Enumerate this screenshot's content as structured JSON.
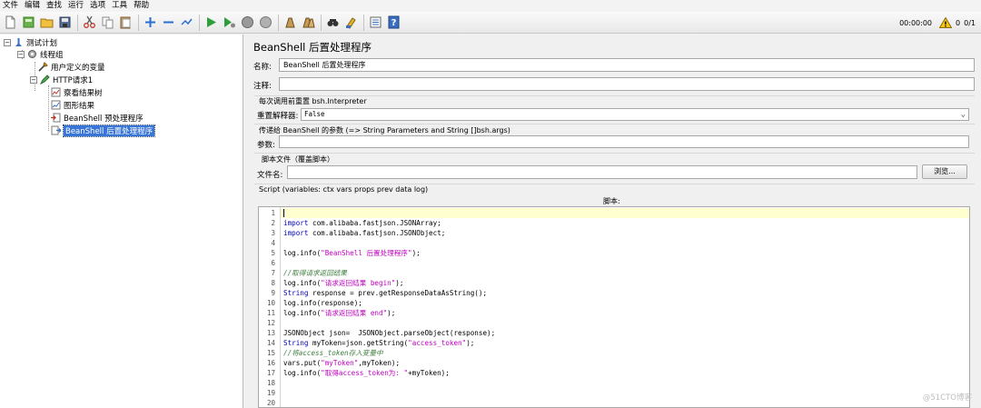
{
  "menu": [
    "文件",
    "编辑",
    "查找",
    "运行",
    "选项",
    "工具",
    "帮助"
  ],
  "toolbar_icons": [
    "new-icon",
    "templates-icon",
    "open-icon",
    "save-icon",
    "cut-icon",
    "copy-icon",
    "paste-icon",
    "expand-icon",
    "collapse-icon",
    "toggle-icon",
    "start-icon",
    "start-no-pause-icon",
    "stop-icon",
    "shutdown-icon",
    "clear-icon",
    "clear-all-icon",
    "search-icon",
    "reset-search-icon",
    "function-helper-icon",
    "help-icon"
  ],
  "status": {
    "timer": "00:00:00",
    "warnings": "0",
    "threads": "0/1"
  },
  "tree": {
    "test_plan": "测试计划",
    "thread_group": "线程组",
    "user_vars": "用户定义的变量",
    "http_request": "HTTP请求1",
    "view_results_tree": "察看结果树",
    "graph_results": "图形结果",
    "beanshell_pre": "BeanShell 预处理程序",
    "beanshell_post": "BeanShell 后置处理程序"
  },
  "panel": {
    "title": "BeanShell 后置处理程序",
    "name_label": "名称:",
    "name_value": "BeanShell 后置处理程序",
    "comment_label": "注释:",
    "comment_value": "",
    "reset_group_title": "每次调用前重置 bsh.Interpreter",
    "reset_label": "重置解释器:",
    "reset_value": "False",
    "params_group_title": "传递给 BeanShell 的参数 (=> String Parameters and String []bsh.args)",
    "params_label": "参数:",
    "params_value": "",
    "file_group_title": "脚本文件（覆盖脚本）",
    "file_label": "文件名:",
    "file_value": "",
    "browse_label": "浏览...",
    "script_group_title": "Script (variables: ctx vars props prev data log)",
    "script_label": "脚本:"
  },
  "code_lines": [
    [],
    [
      [
        "kw",
        "import"
      ],
      [
        "t",
        " com.alibaba.fastjson.JSONArray;"
      ]
    ],
    [
      [
        "kw",
        "import"
      ],
      [
        "t",
        " com.alibaba.fastjson.JSONObject;"
      ]
    ],
    [],
    [
      [
        "t",
        "log.info("
      ],
      [
        "str",
        "\"BeanShell 后置处理程序\""
      ],
      [
        "t",
        ");"
      ]
    ],
    [],
    [
      [
        "cm",
        "//取得请求返回结果"
      ]
    ],
    [
      [
        "t",
        "log.info("
      ],
      [
        "str",
        "\"请求返回结果 begin\""
      ],
      [
        "t",
        ");"
      ]
    ],
    [
      [
        "kw",
        "String"
      ],
      [
        "t",
        " response = prev.getResponseDataAsString();"
      ]
    ],
    [
      [
        "t",
        "log.info(response);"
      ]
    ],
    [
      [
        "t",
        "log.info("
      ],
      [
        "str",
        "\"请求返回结果 end\""
      ],
      [
        "t",
        ");"
      ]
    ],
    [],
    [
      [
        "t",
        "JSONObject json=  JSONObject.parseObject(response);"
      ]
    ],
    [
      [
        "kw",
        "String"
      ],
      [
        "t",
        " myToken=json.getString("
      ],
      [
        "str",
        "\"access_token\""
      ],
      [
        "t",
        ");"
      ]
    ],
    [
      [
        "cm",
        "//将access_token存入变量中"
      ]
    ],
    [
      [
        "t",
        "vars.put("
      ],
      [
        "str",
        "\"myToken\""
      ],
      [
        "t",
        ",myToken);"
      ]
    ],
    [
      [
        "t",
        "log.info("
      ],
      [
        "str",
        "\"取得access_token为: \""
      ],
      [
        "t",
        "+myToken);"
      ]
    ],
    [],
    [],
    []
  ],
  "watermark": "@51CTO博客"
}
